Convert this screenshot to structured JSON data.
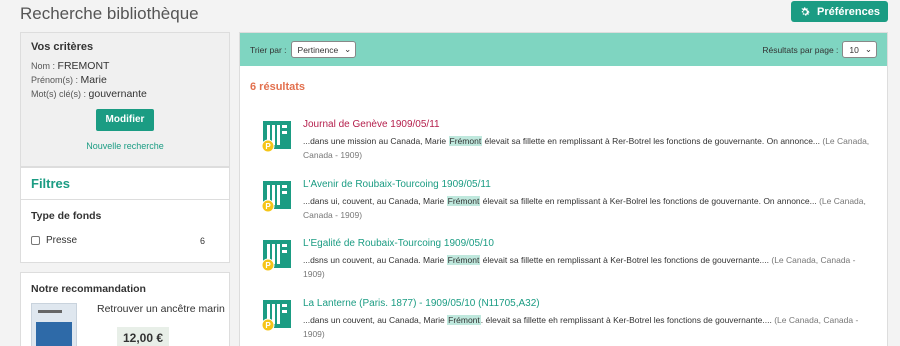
{
  "header": {
    "title": "Recherche bibliothèque",
    "preferences_label": "Préférences"
  },
  "criteria": {
    "title": "Vos critères",
    "nom_label": "Nom :",
    "nom_value": "FREMONT",
    "prenom_label": "Prénom(s) :",
    "prenom_value": "Marie",
    "mots_label": "Mot(s) clé(s) :",
    "mots_value": "gouvernante",
    "modify_label": "Modifier",
    "new_search_label": "Nouvelle recherche"
  },
  "filters": {
    "title": "Filtres",
    "fund_title": "Type de fonds",
    "option_label": "Presse",
    "option_count": "6"
  },
  "recommendation": {
    "title": "Notre recommandation",
    "book_title": "Retrouver un ancêtre marin",
    "price": "12,00 €"
  },
  "toolbar": {
    "sort_label": "Trier par :",
    "sort_value": "Pertinence",
    "per_page_label": "Résultats par page :",
    "per_page_value": "10"
  },
  "results": {
    "count_label": "6 résultats",
    "items": [
      {
        "title": "Journal de Genève 1909/05/11",
        "before": "...dans une mission au Canada, Marie ",
        "hl": "Frémont",
        "after": " élevait sa fillette en remplissant à Rer-Botrel les fonctions de gouvernante. On annonce... ",
        "source": "(Le Canada, Canada - 1909)"
      },
      {
        "title": "L'Avenir de Roubaix-Tourcoing 1909/05/11",
        "before": "...dans ui, couvent, au Canada, Marie ",
        "hl": "Frémont",
        "after": " élevait sa fillelte en remplissant à Ker-Bolrel les fonctions de gouvernante. On annonce... ",
        "source": "(Le Canada, Canada - 1909)"
      },
      {
        "title": "L'Egalité de Roubaix-Tourcoing 1909/05/10",
        "before": "...dsns un couvent, au Canada. Marie ",
        "hl": "Frémont",
        "after": " élevait sa fillette en remplissant à Ker-Botrel les fonctions de gouvernante.... ",
        "source": "(Le Canada, Canada - 1909)"
      },
      {
        "title": "La Lanterne (Paris. 1877) - 1909/05/10 (N11705,A32)",
        "before": "...dans un couvent, au Canada, Marie ",
        "hl": "Frémont",
        "after": ". élevait sa fillette eh remplissant à Ker-Botrel les fonctions de gouvernante.... ",
        "source": "(Le Canada, Canada - 1909)"
      }
    ]
  },
  "colors": {
    "accent": "#1b9c83",
    "toolbar_bg": "#7fd5c1",
    "count": "#e2704e",
    "visited": "#b5204d"
  }
}
